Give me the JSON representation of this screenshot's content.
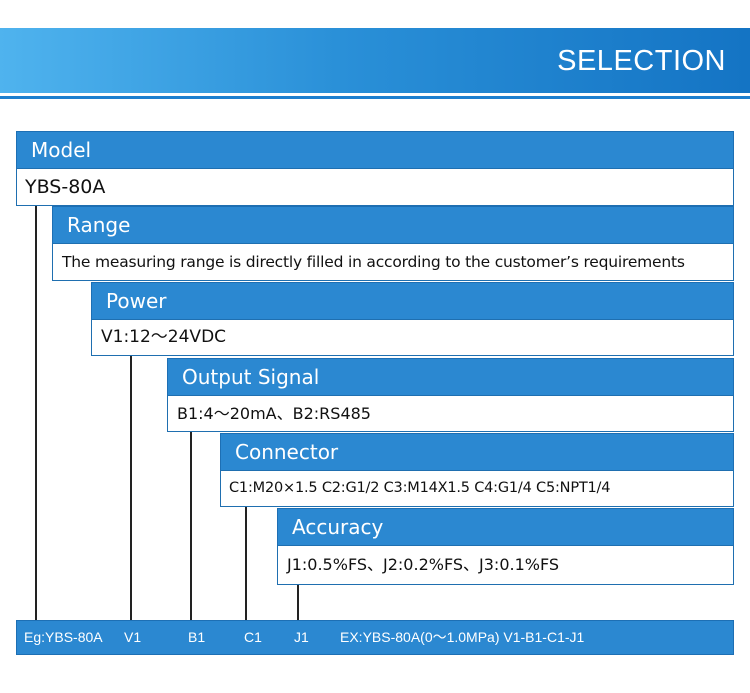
{
  "header": {
    "title": "SELECTION"
  },
  "model": {
    "label": "Model",
    "value": "YBS-80A"
  },
  "range": {
    "label": "Range",
    "value": "The measuring range is directly filled in according to the customer’s requirements"
  },
  "power": {
    "label": "Power",
    "value": "V1:12～24VDC"
  },
  "output_signal": {
    "label": "Output Signal",
    "value": "B1:4～20mA、B2:RS485"
  },
  "connector": {
    "label": "Connector",
    "value": "C1:M20×1.5  C2:G1/2  C3:M14X1.5 C4:G1/4 C5:NPT1/4"
  },
  "accuracy": {
    "label": "Accuracy",
    "value": "J1:0.5%FS、J2:0.2%FS、J3:0.1%FS"
  },
  "example": {
    "eg": "Eg:YBS-80A",
    "v": "V1",
    "b": "B1",
    "c": "C1",
    "j": "J1",
    "ex": "EX:YBS-80A(0～1.0MPa) V1-B1-C1-J1"
  },
  "colors": {
    "accent": "#2b88d1",
    "banner_start": "#4fb3ee",
    "banner_end": "#1474c4"
  }
}
